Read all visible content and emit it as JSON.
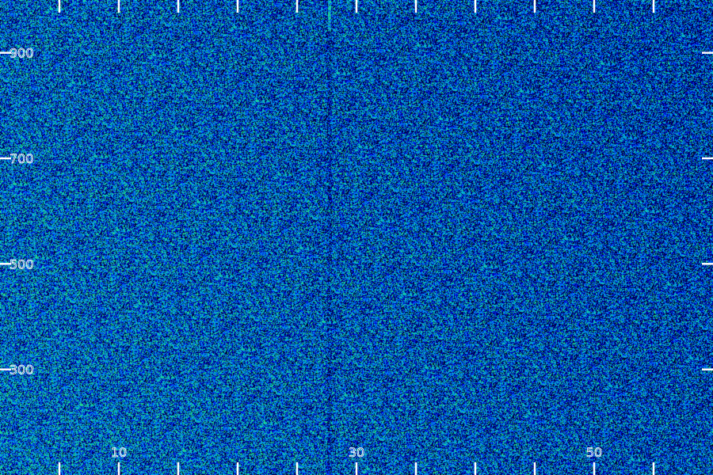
{
  "chart_data": {
    "type": "heatmap",
    "title": "",
    "xlabel": "",
    "ylabel": "",
    "x_ticks": [
      {
        "label": "10",
        "value": 10
      },
      {
        "label": "30",
        "value": 30
      },
      {
        "label": "50",
        "value": 50
      }
    ],
    "y_ticks": [
      {
        "label": "300",
        "value": 300
      },
      {
        "label": "500",
        "value": 500
      },
      {
        "label": "700",
        "value": 700
      },
      {
        "label": "900",
        "value": 900
      }
    ],
    "xlim": [
      0,
      60
    ],
    "ylim": [
      100,
      1000
    ],
    "x_minor_step": 5,
    "colormap": [
      "#000033",
      "#0000cc",
      "#0077ff",
      "#00bbcc",
      "#22dd88"
    ],
    "description_of_values": "",
    "grid": false,
    "features": {
      "dominant_intensity": "low-to-medium noise",
      "vertical_streak_x": 27.7
    }
  }
}
